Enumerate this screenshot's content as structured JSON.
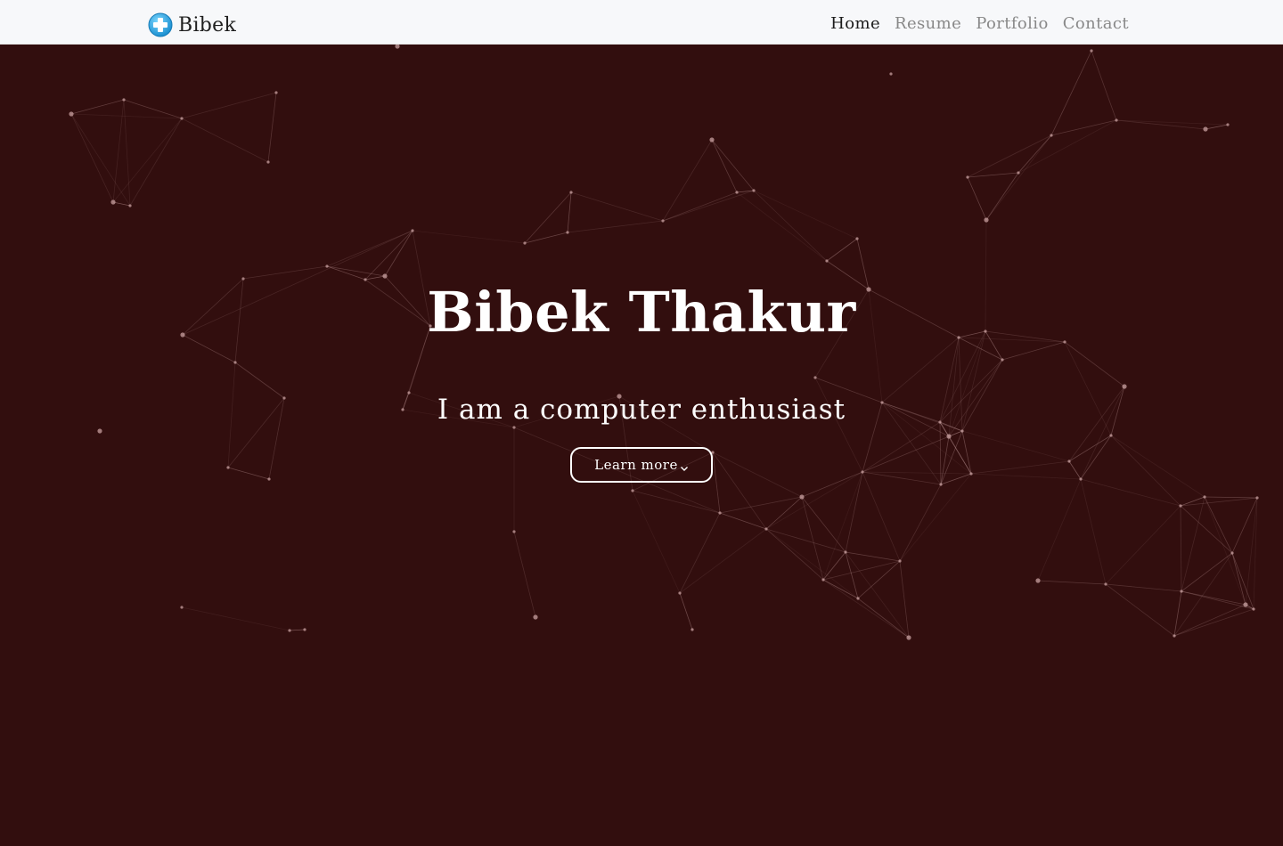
{
  "brand": {
    "name": "Bibek",
    "icon": "plus-circle-icon",
    "icon_color": "#29a8e0"
  },
  "nav": {
    "links": [
      {
        "label": "Home",
        "active": true
      },
      {
        "label": "Resume",
        "active": false
      },
      {
        "label": "Portfolio",
        "active": false
      },
      {
        "label": "Contact",
        "active": false
      }
    ]
  },
  "hero": {
    "title": "Bibek Thakur",
    "subtitle": "I am a computer enthusiast",
    "button_label": "Learn more",
    "button_icon": "chevron-down-icon",
    "background_color": "#320e0e",
    "particle_color": "#c8a0a0"
  }
}
